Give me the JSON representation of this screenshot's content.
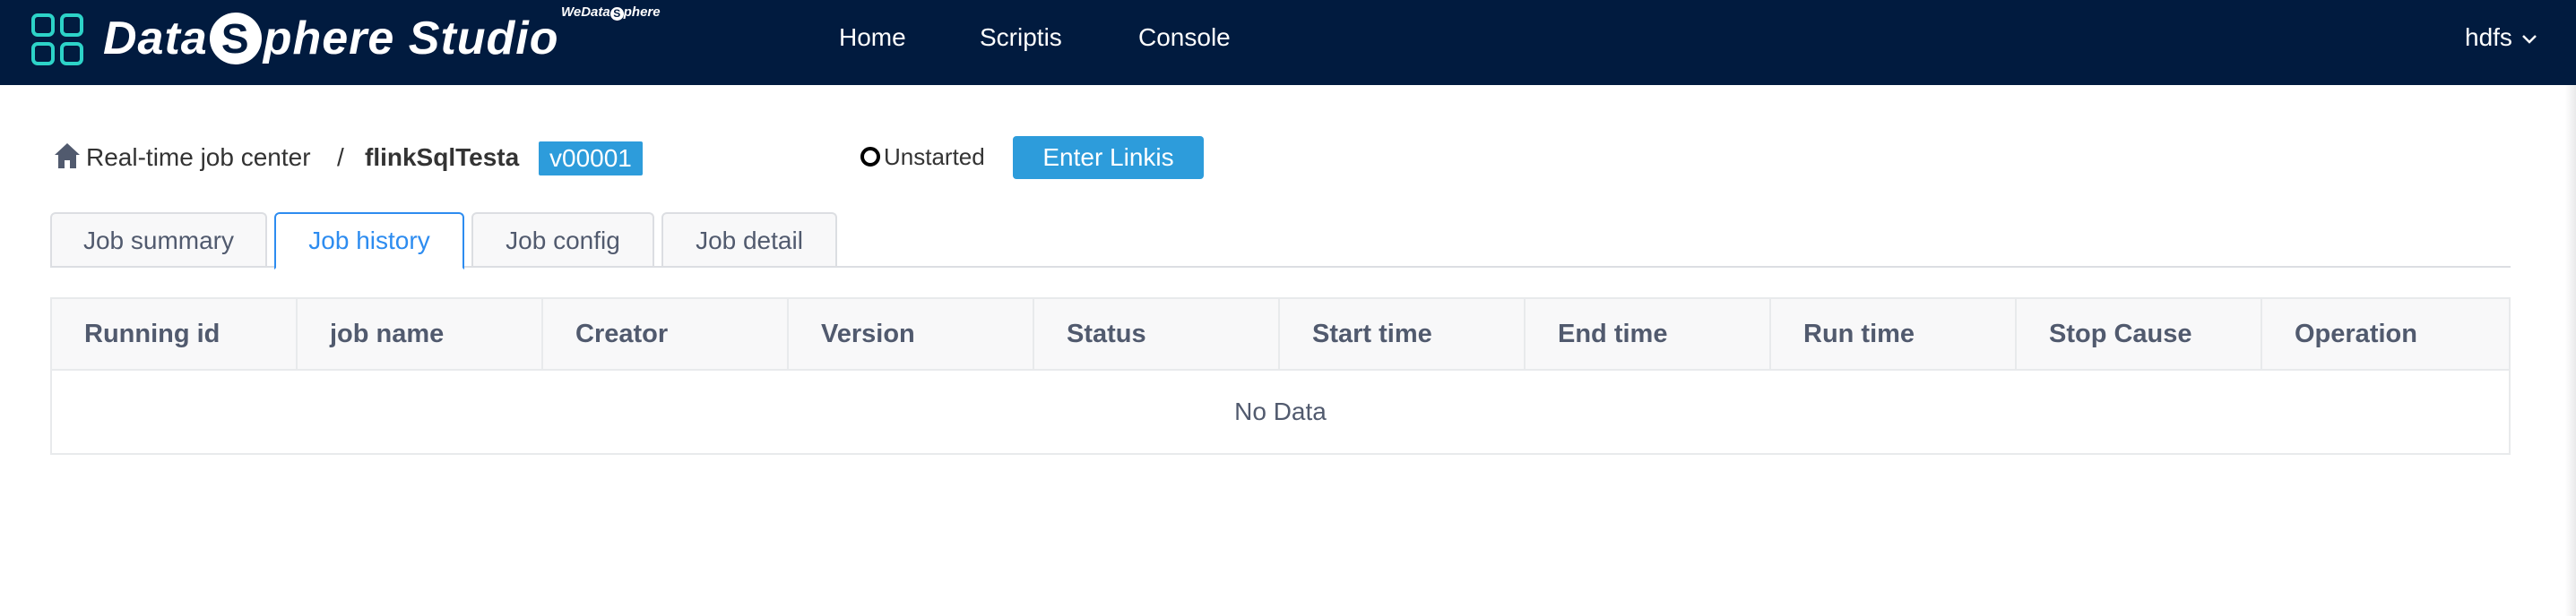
{
  "brand": {
    "name_prefix": "Data",
    "name_s": "S",
    "name_suffix": "phere Studio",
    "sub_prefix": "WeData",
    "sub_s": "S",
    "sub_suffix": "phere",
    "logo_icon": "grid-logo-icon",
    "logo_color": "#2dd3c8"
  },
  "nav": {
    "items": [
      {
        "label": "Home"
      },
      {
        "label": "Scriptis"
      },
      {
        "label": "Console"
      }
    ],
    "user": "hdfs",
    "user_icon": "chevron-down-icon"
  },
  "header": {
    "home_icon": "home-icon",
    "breadcrumb": "Real-time job center",
    "separator": "/",
    "job_name": "flinkSqlTesta",
    "version": "v00001",
    "status": "Unstarted",
    "enter_button": "Enter Linkis"
  },
  "tabs": [
    {
      "label": "Job summary",
      "active": false
    },
    {
      "label": "Job history",
      "active": true
    },
    {
      "label": "Job config",
      "active": false
    },
    {
      "label": "Job detail",
      "active": false
    }
  ],
  "table": {
    "columns": [
      "Running id",
      "job name",
      "Creator",
      "Version",
      "Status",
      "Start time",
      "End time",
      "Run time",
      "Stop Cause",
      "Operation"
    ],
    "empty_text": "No Data"
  },
  "colors": {
    "topbar": "#011b3f",
    "accent": "#2d9cdb",
    "tab_active": "#2d8cf0"
  }
}
